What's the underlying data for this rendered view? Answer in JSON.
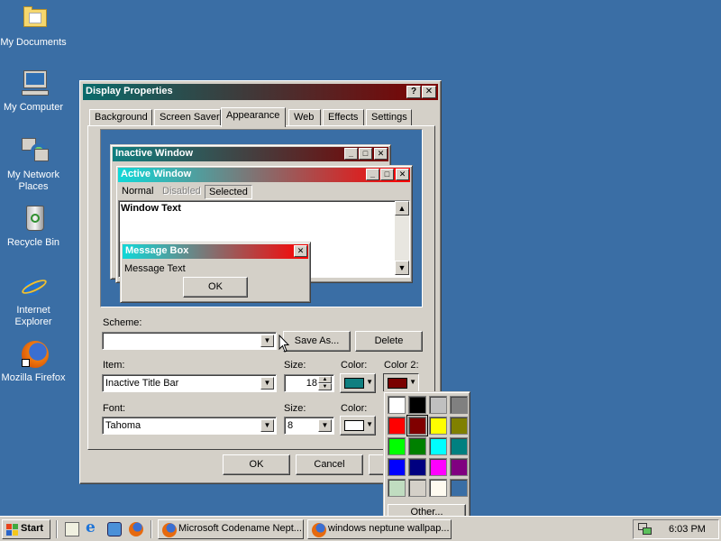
{
  "desktop": {
    "icons": [
      {
        "label": "My Documents"
      },
      {
        "label": "My Computer"
      },
      {
        "label": "My Network Places"
      },
      {
        "label": "Recycle Bin"
      },
      {
        "label": "Internet Explorer"
      },
      {
        "label": "Mozilla Firefox"
      }
    ]
  },
  "dialog": {
    "title": "Display Properties",
    "help_button": "?",
    "close_button": "✕",
    "tabs": [
      "Background",
      "Screen Saver",
      "Appearance",
      "Web",
      "Effects",
      "Settings"
    ],
    "active_tab": "Appearance",
    "preview": {
      "inactive_title": "Inactive Window",
      "active_title": "Active Window",
      "menu_items": [
        "Normal",
        "Disabled",
        "Selected"
      ],
      "window_text": "Window Text",
      "msgbox_title": "Message Box",
      "msgbox_text": "Message Text",
      "msgbox_ok": "OK"
    },
    "scheme": {
      "label": "Scheme:",
      "value": "",
      "save_as": "Save As...",
      "delete": "Delete"
    },
    "item": {
      "label": "Item:",
      "value": "Inactive Title Bar"
    },
    "size1": {
      "label": "Size:",
      "value": "18"
    },
    "color1": {
      "label": "Color:",
      "value": "#0f7f80"
    },
    "color2": {
      "label": "Color 2:",
      "value": "#7a0000"
    },
    "font": {
      "label": "Font:",
      "value": "Tahoma"
    },
    "size2": {
      "label": "Size:",
      "value": "8"
    },
    "fontcolor": {
      "label": "Color:",
      "value": "#ffffff"
    },
    "buttons": {
      "ok": "OK",
      "cancel": "Cancel"
    }
  },
  "palette": {
    "colors": [
      "#ffffff",
      "#000000",
      "#c0c0c0",
      "#808080",
      "#ff0000",
      "#800000",
      "#ffff00",
      "#808000",
      "#00ff00",
      "#008000",
      "#00ffff",
      "#008080",
      "#0000ff",
      "#000080",
      "#ff00ff",
      "#800080",
      "#c0dcc0",
      "#d4d0c8",
      "#fffbf0",
      "#3a6ea5"
    ],
    "selected_index": 5,
    "other_label": "Other..."
  },
  "taskbar": {
    "start_label": "Start",
    "tasks": [
      "Microsoft Codename Nept...",
      "windows neptune wallpap..."
    ],
    "clock": "6:03 PM"
  }
}
